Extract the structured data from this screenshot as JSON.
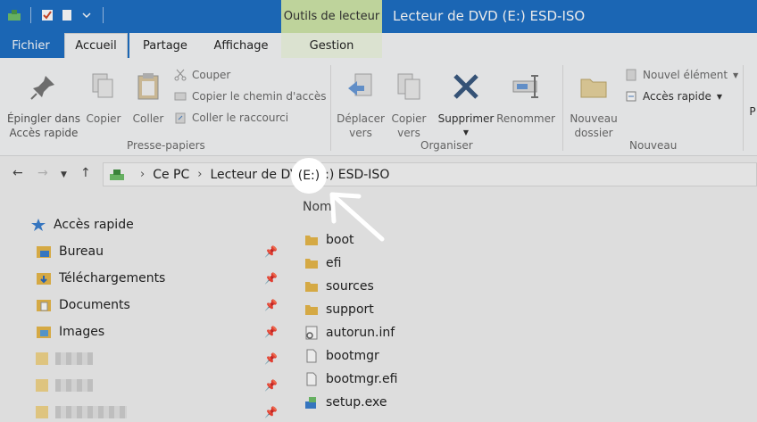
{
  "window": {
    "title": "Lecteur de DVD (E:) ESD-ISO",
    "context_tab_header": "Outils de lecteur"
  },
  "tabs": {
    "file": "Fichier",
    "home": "Accueil",
    "share": "Partage",
    "view": "Affichage",
    "manage": "Gestion"
  },
  "ribbon": {
    "pin_label": "Épingler dans\nAccès rapide",
    "copy_label": "Copier",
    "paste_label": "Coller",
    "cut_label": "Couper",
    "copy_path_label": "Copier le chemin d'accès",
    "paste_shortcut_label": "Coller le raccourci",
    "clipboard_group": "Presse-papiers",
    "move_to_label": "Déplacer\nvers",
    "copy_to_label": "Copier\nvers",
    "delete_label": "Supprimer",
    "rename_label": "Renommer",
    "organize_group": "Organiser",
    "new_folder_label": "Nouveau\ndossier",
    "new_item_label": "Nouvel élément",
    "easy_access_label": "Accès rapide",
    "new_group": "Nouveau",
    "properties_partial": "P"
  },
  "address": {
    "segments": [
      "Ce PC",
      "Lecteur de DVD (E:) ESD-ISO"
    ],
    "highlight_text": "(E:)"
  },
  "nav_pane": {
    "quick_access": "Accès rapide",
    "items": [
      "Bureau",
      "Téléchargements",
      "Documents",
      "Images"
    ]
  },
  "content": {
    "column_name": "Nom",
    "files": [
      "boot",
      "efi",
      "sources",
      "support",
      "autorun.inf",
      "bootmgr",
      "bootmgr.efi",
      "setup.exe"
    ]
  },
  "colors": {
    "title_blue": "#1e6fc4",
    "context_green": "#cfe5a9",
    "folder_yellow": "#e8b84a"
  }
}
